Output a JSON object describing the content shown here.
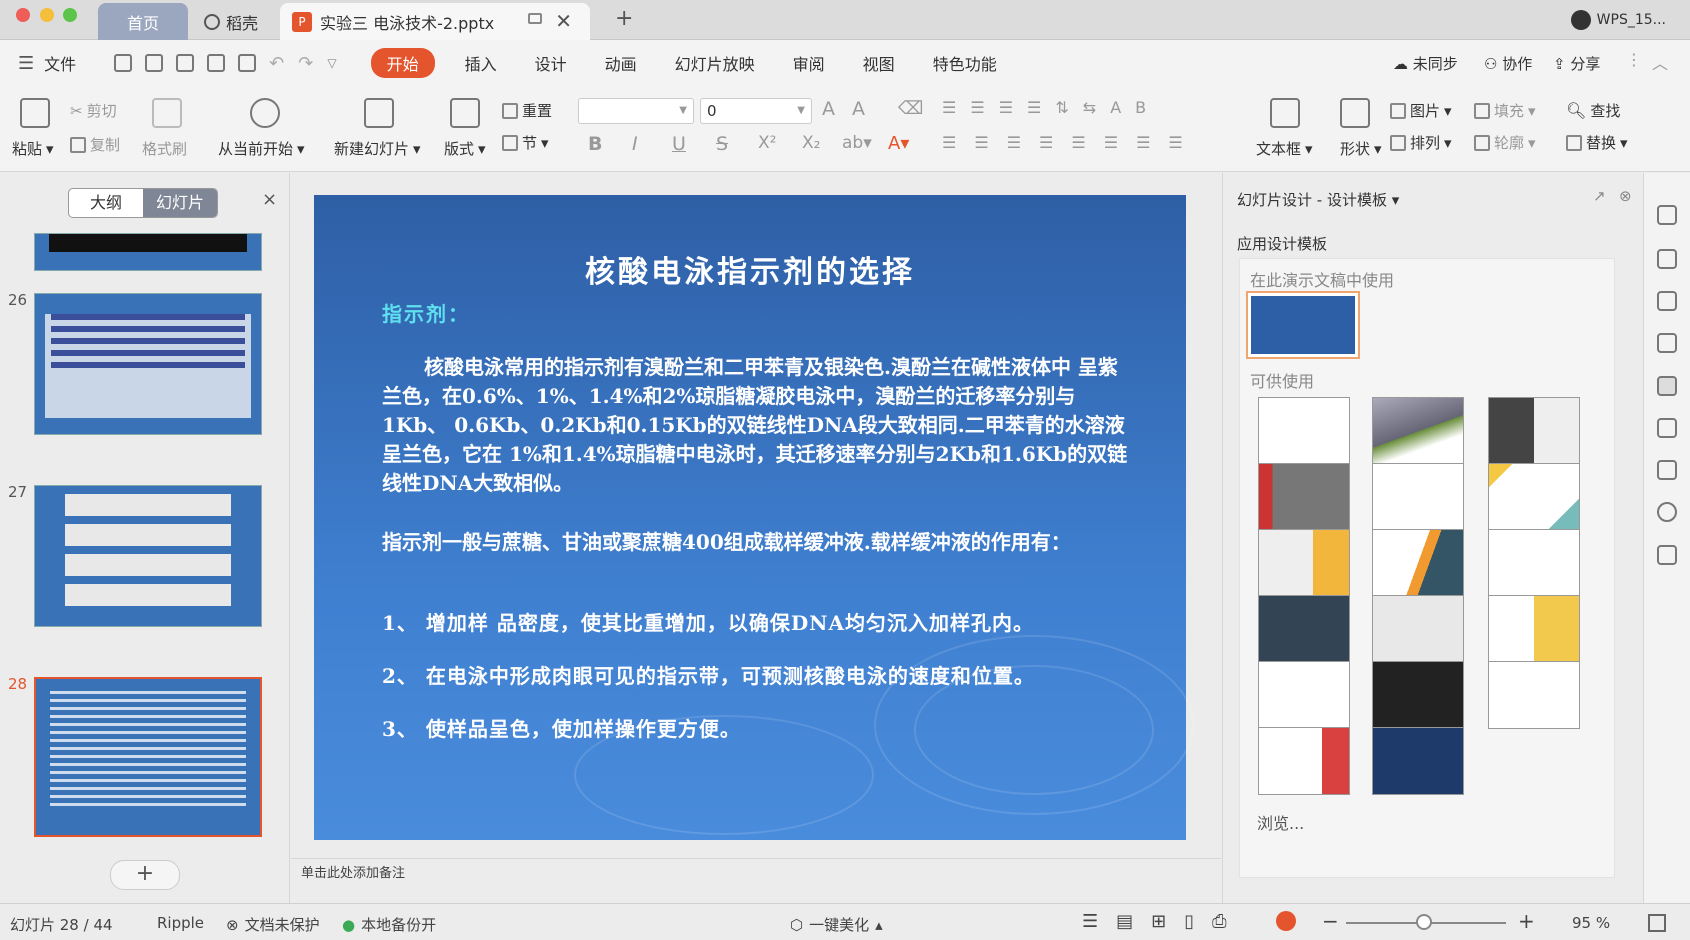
{
  "titlebar": {
    "tab_home": "首页",
    "tab_daoke": "稻壳",
    "tab_doc": "实验三 电泳技术-2.pptx",
    "user": "WPS_15...",
    "new_tab": "+"
  },
  "menubar": {
    "file": "文件",
    "items": [
      "开始",
      "插入",
      "设计",
      "动画",
      "幻灯片放映",
      "审阅",
      "视图",
      "特色功能"
    ],
    "unsynced": "未同步",
    "collab": "协作",
    "share": "分享"
  },
  "ribbon": {
    "paste": "粘贴",
    "cut": "剪切",
    "copy": "复制",
    "format_painter": "格式刷",
    "from_current": "从当前开始",
    "new_slide": "新建幻灯片",
    "layout": "版式",
    "reset": "重置",
    "section": "节",
    "font_size": "0",
    "textbox": "文本框",
    "shape": "形状",
    "picture": "图片",
    "arrange": "排列",
    "fill": "填充",
    "outline": "轮廓",
    "find": "查找",
    "replace": "替换"
  },
  "leftpanel": {
    "outline": "大纲",
    "slides": "幻灯片",
    "close": "×",
    "slide_numbers": [
      "26",
      "27",
      "28"
    ],
    "add": "+"
  },
  "slide": {
    "title": "核酸电泳指示剂的选择",
    "subtitle": "指示剂：",
    "para1": "核酸电泳常用的指示剂有溴酚兰和二甲苯青及银染色.溴酚兰在碱性液体中 呈紫兰色，在0.6%、1%、1.4%和2%琼脂糖凝胶电泳中，溴酚兰的迁移率分别与1Kb、 0.6Kb、0.2Kb和0.15Kb的双链线性DNA段大致相同.二甲苯青的水溶液呈兰色，它在 1%和1.4%琼脂糖中电泳时，其迁移速率分别与2Kb和1.6Kb的双链线性DNA大致相似。",
    "para2": "指示剂一般与蔗糖、甘油或聚蔗糖400组成载样缓冲液.载样缓冲液的作用有：",
    "point1": "1、 增加样 品密度，使其比重增加，以确保DNA均匀沉入加样孔内。",
    "point2": "2、 在电泳中形成肉眼可见的指示带，可预测核酸电泳的速度和位置。",
    "point3": "3、 使样品呈色，使加样操作更方便。"
  },
  "notes": "单击此处添加备注",
  "rightpanel": {
    "title": "幻灯片设计 - 设计模板",
    "apply": "应用设计模板",
    "in_use": "在此演示文稿中使用",
    "available": "可供使用",
    "browse": "浏览..."
  },
  "statusbar": {
    "slide_count": "幻灯片 28 / 44",
    "theme": "Ripple",
    "protect": "文档未保护",
    "backup": "本地备份开",
    "beautify": "一键美化",
    "zoom": "95 %"
  },
  "colors": {
    "accent": "#e4552d",
    "slide_bg": "#3a72c0",
    "subtitle": "#5fe0f0"
  }
}
